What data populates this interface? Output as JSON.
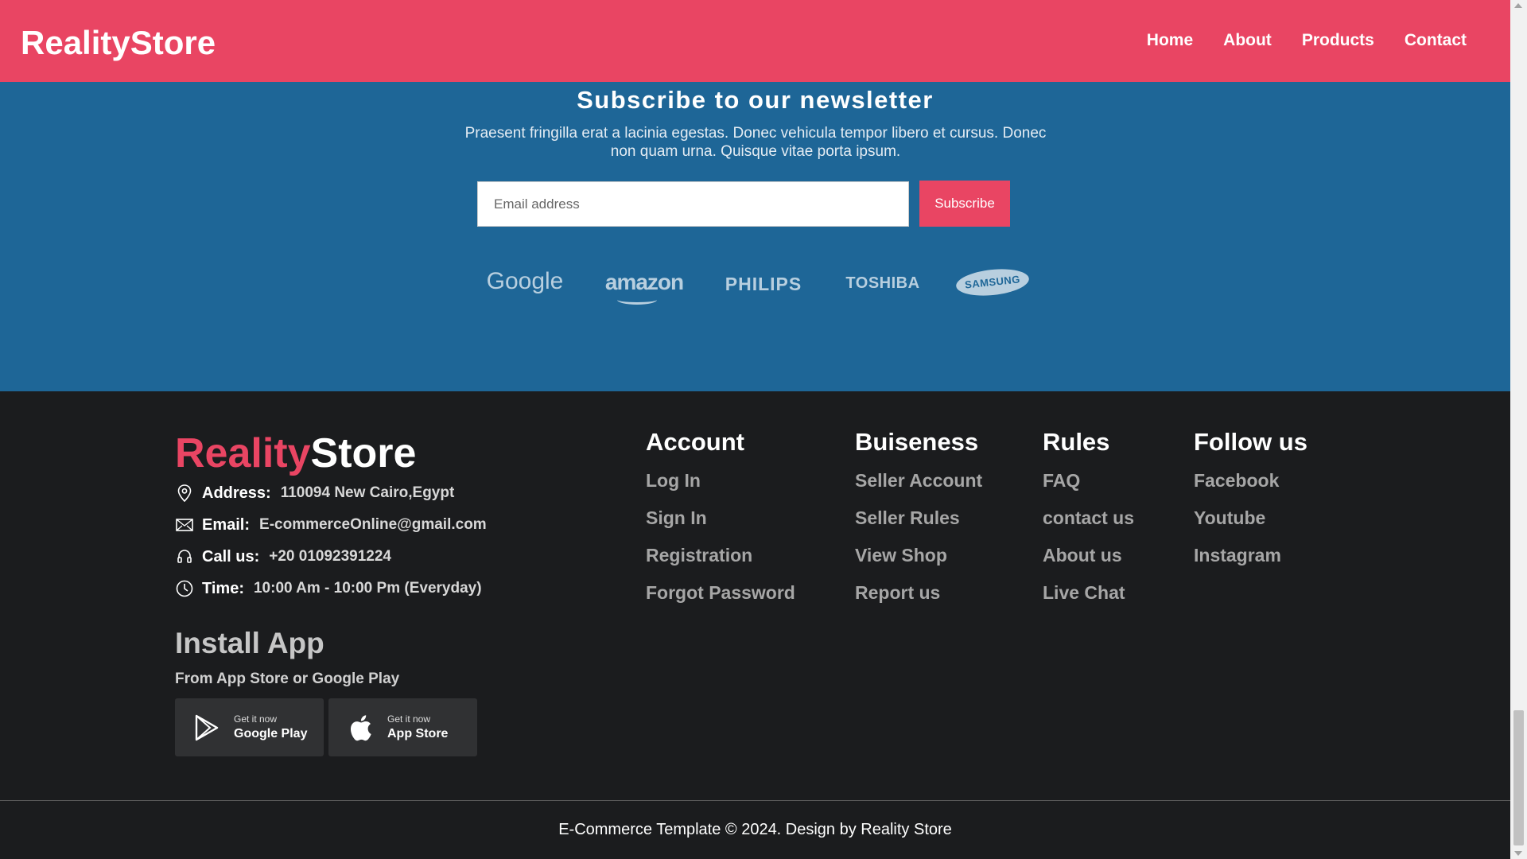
{
  "header": {
    "logo": "RealityStore",
    "nav": [
      "Home",
      "About",
      "Products",
      "Contact"
    ]
  },
  "newsletter": {
    "title": "Subscribe to our newsletter",
    "text": "Praesent fringilla erat a lacinia egestas. Donec vehicula tempor libero et cursus. Donec non quam urna. Quisque vitae porta ipsum.",
    "email_placeholder": "Email address",
    "subscribe_label": "Subscribe",
    "brands": [
      "Google",
      "amazon",
      "PHILIPS",
      "TOSHIBA",
      "SAMSUNG"
    ]
  },
  "footer": {
    "logo_accent": "Reality",
    "logo_rest": "Store",
    "contact": {
      "address_label": "Address:",
      "address_value": "110094 New Cairo,Egypt",
      "email_label": "Email:",
      "email_value": "E-commerceOnline@gmail.com",
      "call_label": "Call us:",
      "call_value": "+20 01092391224",
      "time_label": "Time:",
      "time_value": "10:00 Am - 10:00 Pm (Everyday)"
    },
    "install": {
      "title": "Install App",
      "subtitle": "From App Store or Google Play",
      "google_small": "Get it now",
      "google_big": "Google Play",
      "apple_small": "Get it now",
      "apple_big": "App Store"
    },
    "columns": [
      {
        "title": "Account",
        "links": [
          "Log In",
          "Sign In",
          "Registration",
          "Forgot Password"
        ]
      },
      {
        "title": "Buiseness",
        "links": [
          "Seller Account",
          "Seller Rules",
          "View Shop",
          "Report us"
        ]
      },
      {
        "title": "Rules",
        "links": [
          "FAQ",
          "contact us",
          "About us",
          "Live Chat"
        ]
      },
      {
        "title": "Follow us",
        "links": [
          "Facebook",
          "Youtube",
          "Instagram"
        ]
      }
    ],
    "copyright": "E-Commerce Template © 2024. Design by Reality Store"
  },
  "colors": {
    "accent": "#e94563",
    "newsletter_bg": "#1e6697",
    "footer_bg": "#1b1c1e"
  }
}
